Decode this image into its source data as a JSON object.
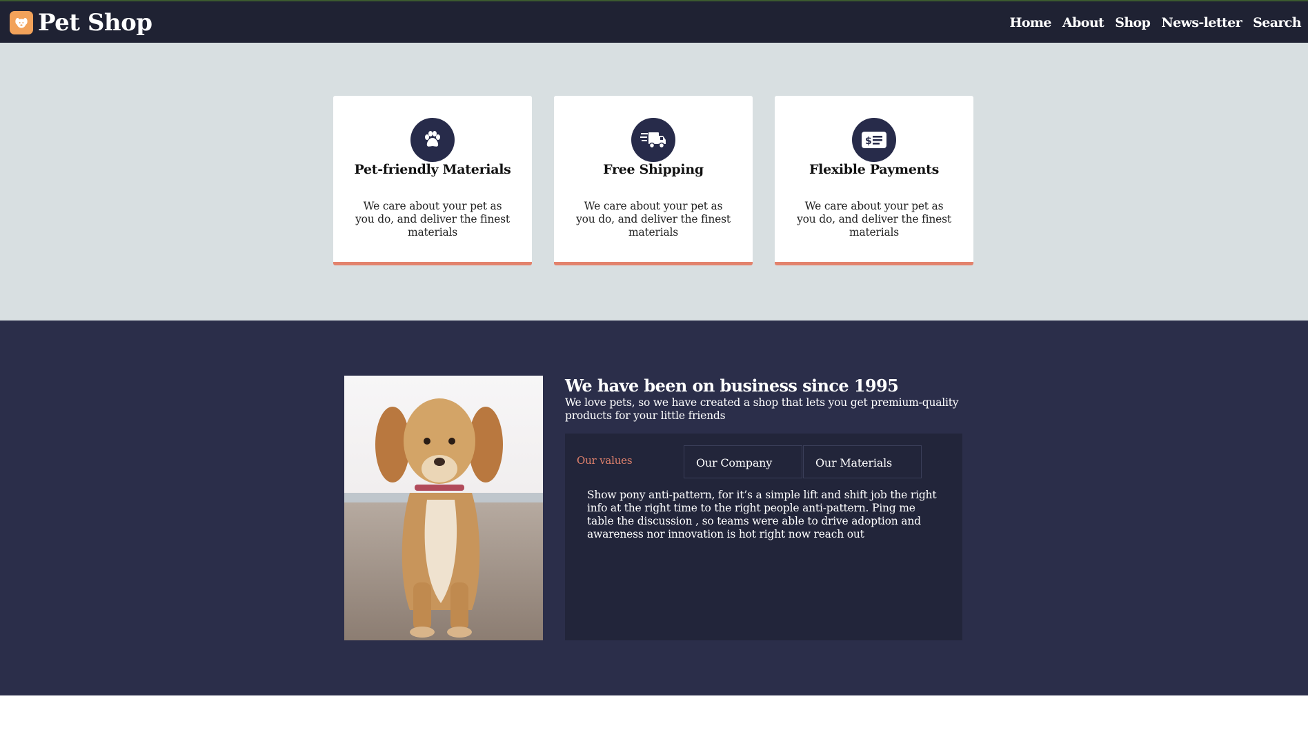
{
  "header": {
    "brand": "Pet Shop",
    "nav": [
      "Home",
      "About",
      "Shop",
      "News-letter",
      "Search"
    ]
  },
  "features": [
    {
      "icon": "paw-icon",
      "title": "Pet-friendly Materials",
      "text": "We care about your pet as you do, and deliver the finest materials"
    },
    {
      "icon": "shipping-truck-icon",
      "title": "Free Shipping",
      "text": "We care about your pet as you do, and deliver the finest materials"
    },
    {
      "icon": "money-bill-icon",
      "title": "Flexible Payments",
      "text": "We care about your pet as you do, and deliver the finest materials"
    }
  ],
  "about": {
    "title": "We have been on business since 1995",
    "subtitle": "We love pets, so we have created a shop that lets you get premium-quality products for your little friends",
    "tabs": [
      "Our values",
      "Our Company",
      "Our Materials"
    ],
    "active_tab": "Our values",
    "tab_content": "Show pony anti-pattern, for it’s a simple lift and shift job the right info at the right time to the right people anti-pattern. Ping me table the discussion , so teams were able to drive adoption and awareness nor innovation is hot right now reach out"
  },
  "colors": {
    "navbar": "#1f2233",
    "accent": "#e3836d",
    "features_bg": "#d8dfe1",
    "about_bg": "#2b2e4a",
    "icon_bg": "#272b4a",
    "logo": "#f2a25a"
  }
}
